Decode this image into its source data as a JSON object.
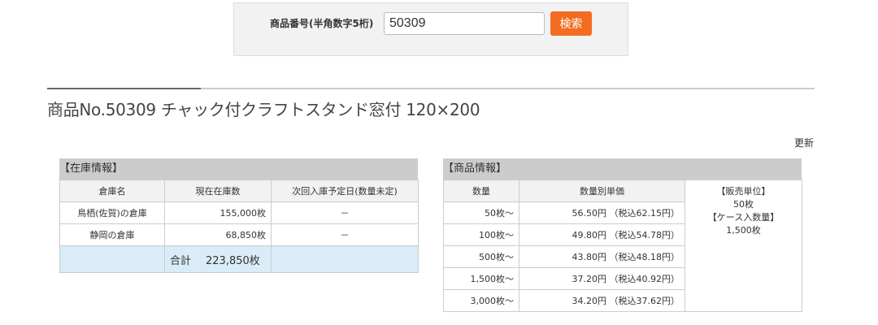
{
  "search": {
    "label": "商品番号(半角数字5桁)",
    "value": "50309",
    "button_label": "検索"
  },
  "product": {
    "title": "商品No.50309 チャック付クラフトスタンド窓付 120×200"
  },
  "update_label": "更新",
  "inventory": {
    "heading": "【在庫情報】",
    "columns": [
      "倉庫名",
      "現在在庫数",
      "次回入庫予定日(数量未定)"
    ],
    "rows": [
      {
        "warehouse": "鳥栖(佐賀)の倉庫",
        "stock": "155,000枚",
        "next": "－"
      },
      {
        "warehouse": "静岡の倉庫",
        "stock": "68,850枚",
        "next": "－"
      }
    ],
    "total_label": "合計",
    "total_value": "223,850枚"
  },
  "product_info": {
    "heading": "【商品情報】",
    "columns": [
      "数量",
      "数量別単価"
    ],
    "rows": [
      {
        "qty": "50枚～",
        "price": "56.50円 （税込62.15円）"
      },
      {
        "qty": "100枚～",
        "price": "49.80円 （税込54.78円）"
      },
      {
        "qty": "500枚～",
        "price": "43.80円 （税込48.18円）"
      },
      {
        "qty": "1,500枚～",
        "price": "37.20円 （税込40.92円）"
      },
      {
        "qty": "3,000枚～",
        "price": "34.20円 （税込37.62円）"
      }
    ],
    "sales_unit_label": "【販売単位】",
    "sales_unit_value": "50枚",
    "case_qty_label": "【ケース入数量】",
    "case_qty_value": "1,500枚"
  }
}
